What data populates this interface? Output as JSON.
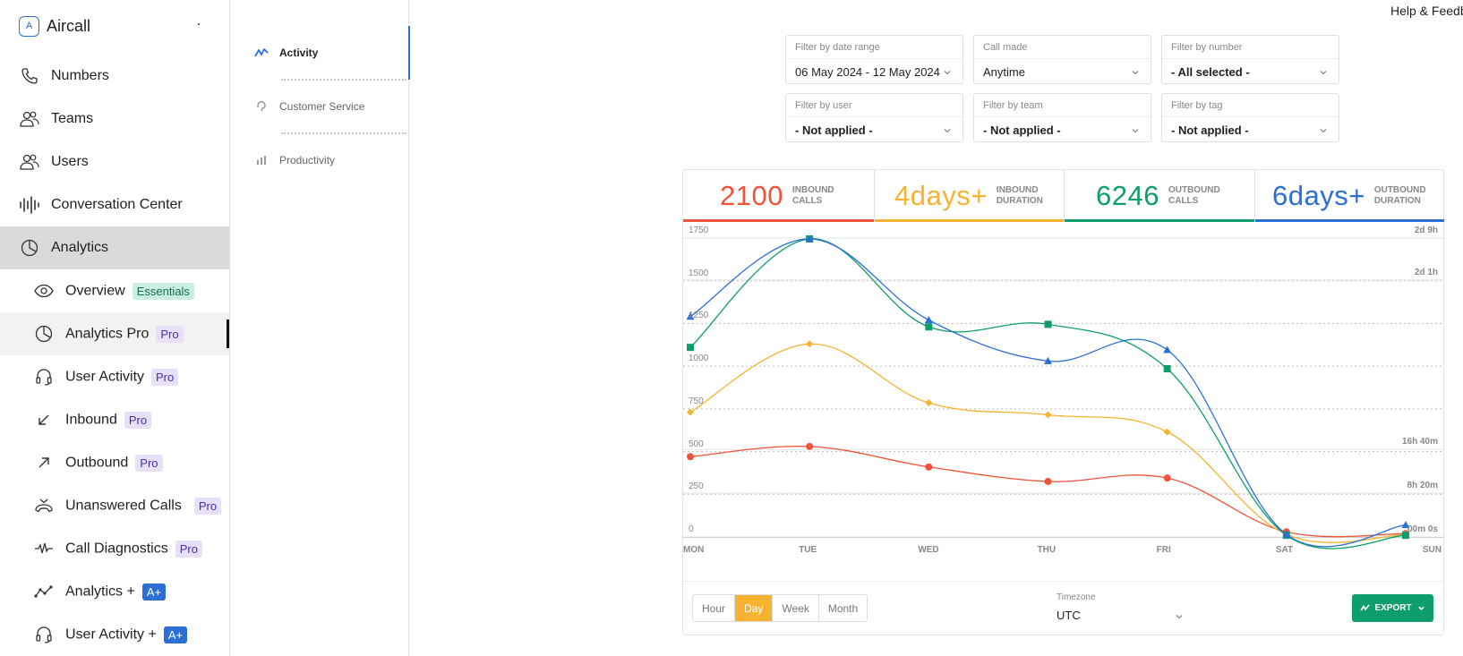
{
  "brand": {
    "name": "Aircall",
    "logo_letter": "A"
  },
  "help_link": "Help & Feedb",
  "sidebar": {
    "items": [
      {
        "label": "Numbers",
        "icon": "phone-icon"
      },
      {
        "label": "Teams",
        "icon": "teams-icon"
      },
      {
        "label": "Users",
        "icon": "users-icon"
      },
      {
        "label": "Conversation Center",
        "icon": "waveform-icon"
      },
      {
        "label": "Analytics",
        "icon": "pie-chart-icon",
        "active": true
      }
    ],
    "sub_items": [
      {
        "label": "Overview",
        "icon": "eye-icon",
        "badge": "Essentials",
        "badge_type": "ess"
      },
      {
        "label": "Analytics Pro",
        "icon": "pie-chart-icon",
        "badge": "Pro",
        "badge_type": "pro",
        "selected": true
      },
      {
        "label": "User Activity",
        "icon": "headset-icon",
        "badge": "Pro",
        "badge_type": "pro"
      },
      {
        "label": "Inbound",
        "icon": "arrow-down-left-icon",
        "badge": "Pro",
        "badge_type": "pro"
      },
      {
        "label": "Outbound",
        "icon": "arrow-up-right-icon",
        "badge": "Pro",
        "badge_type": "pro"
      },
      {
        "label": "Unanswered Calls",
        "icon": "missed-call-icon",
        "badge": "Pro",
        "badge_type": "pro"
      },
      {
        "label": "Call Diagnostics",
        "icon": "pulse-icon",
        "badge": "Pro",
        "badge_type": "pro"
      },
      {
        "label": "Analytics +",
        "icon": "trend-icon",
        "badge": "A+",
        "badge_type": "aplus"
      },
      {
        "label": "User Activity +",
        "icon": "headset-icon",
        "badge": "A+",
        "badge_type": "aplus"
      }
    ]
  },
  "subnav": {
    "items": [
      {
        "label": "Activity",
        "icon": "activity-icon",
        "active": true
      },
      {
        "label": "Customer Service",
        "icon": "support-icon"
      },
      {
        "label": "Productivity",
        "icon": "bars-icon"
      }
    ]
  },
  "filters": {
    "date_range": {
      "label": "Filter by date range",
      "value": "06 May 2024 - 12 May 2024"
    },
    "call_made": {
      "label": "Call made",
      "value": "Anytime"
    },
    "number": {
      "label": "Filter by number",
      "value": "- All selected -"
    },
    "user": {
      "label": "Filter by user",
      "value": "- Not applied -"
    },
    "team": {
      "label": "Filter by team",
      "value": "- Not applied -"
    },
    "tag": {
      "label": "Filter by tag",
      "value": "- Not applied -"
    }
  },
  "kpis": [
    {
      "value": "2100",
      "line1": "INBOUND",
      "line2": "CALLS",
      "color": "#f0533a"
    },
    {
      "value": "4days+",
      "line1": "INBOUND",
      "line2": "DURATION",
      "color": "#f6b331"
    },
    {
      "value": "6246",
      "line1": "OUTBOUND",
      "line2": "CALLS",
      "color": "#0d9e6b"
    },
    {
      "value": "6days+",
      "line1": "OUTBOUND",
      "line2": "DURATION",
      "color": "#2b6fd6"
    }
  ],
  "chart_data": {
    "type": "line",
    "categories": [
      "MON",
      "TUE",
      "WED",
      "THU",
      "FRI",
      "SAT",
      "SUN"
    ],
    "y_ticks": [
      "1750",
      "1500",
      "1250",
      "1000",
      "750",
      "500",
      "250",
      "0"
    ],
    "ylim": [
      0,
      1750
    ],
    "right_ticks": [
      "2d 9h",
      "2d 1h",
      "16h 40m",
      "8h 20m",
      "00m 0s"
    ],
    "right_lim_hours": [
      0,
      57
    ],
    "grid": true,
    "series": [
      {
        "color": "#f0533a",
        "marker": "circle",
        "axis": "left",
        "values": [
          470,
          530,
          410,
          325,
          345,
          30,
          20
        ]
      },
      {
        "color": "#f6b331",
        "marker": "diamond",
        "axis": "left",
        "values": [
          730,
          1130,
          785,
          715,
          615,
          15,
          15
        ]
      },
      {
        "color": "#0d9e6b",
        "marker": "square",
        "axis": "left",
        "values": [
          1110,
          1745,
          1230,
          1245,
          985,
          10,
          10
        ]
      },
      {
        "color": "#2b6fd6",
        "marker": "triangle",
        "axis": "left",
        "values": [
          1290,
          1745,
          1270,
          1030,
          1095,
          15,
          70
        ]
      }
    ]
  },
  "controls": {
    "granularity": [
      "Hour",
      "Day",
      "Week",
      "Month"
    ],
    "granularity_selected": "Day",
    "timezone_label": "Timezone",
    "timezone_value": "UTC",
    "export_label": "EXPORT"
  }
}
